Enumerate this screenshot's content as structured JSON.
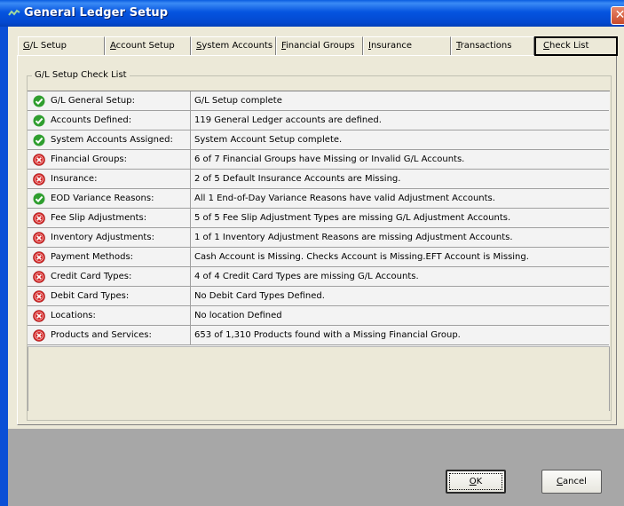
{
  "window": {
    "title": "General Ledger Setup"
  },
  "tabs": [
    {
      "prefix": "",
      "accel": "G",
      "rest": "/L Setup"
    },
    {
      "prefix": "",
      "accel": "A",
      "rest": "ccount Setup"
    },
    {
      "prefix": "",
      "accel": "S",
      "rest": "ystem Accounts"
    },
    {
      "prefix": "",
      "accel": "F",
      "rest": "inancial Groups"
    },
    {
      "prefix": "",
      "accel": "I",
      "rest": "nsurance"
    },
    {
      "prefix": "",
      "accel": "T",
      "rest": "ransactions"
    },
    {
      "prefix": "",
      "accel": "C",
      "rest": "heck List",
      "selected": true
    }
  ],
  "group": {
    "label": "G/L Setup Check List"
  },
  "checklist": [
    {
      "status": "ok",
      "icon": "green-check-icon",
      "name": "G/L General Setup:",
      "message": "G/L Setup complete"
    },
    {
      "status": "ok",
      "icon": "green-check-icon",
      "name": "Accounts Defined:",
      "message": "119 General Ledger accounts are defined."
    },
    {
      "status": "ok",
      "icon": "green-check-icon",
      "name": "System Accounts Assigned:",
      "message": "System Account Setup complete."
    },
    {
      "status": "error",
      "icon": "red-x-icon",
      "name": "Financial Groups:",
      "message": "6 of 7 Financial Groups have Missing or Invalid G/L Accounts."
    },
    {
      "status": "error",
      "icon": "red-x-icon",
      "name": "Insurance:",
      "message": "2 of 5 Default Insurance Accounts are Missing."
    },
    {
      "status": "ok",
      "icon": "green-check-icon",
      "name": "EOD Variance Reasons:",
      "message": "All 1 End-of-Day Variance Reasons have valid Adjustment Accounts."
    },
    {
      "status": "error",
      "icon": "red-x-icon",
      "name": "Fee Slip Adjustments:",
      "message": "5 of 5  Fee Slip Adjustment Types are missing G/L Adjustment Accounts."
    },
    {
      "status": "error",
      "icon": "red-x-icon",
      "name": "Inventory Adjustments:",
      "message": "1 of 1  Inventory Adjustment Reasons are missing Adjustment Accounts."
    },
    {
      "status": "error",
      "icon": "red-x-icon",
      "name": "Payment Methods:",
      "message": "Cash Account is Missing.  Checks Account is Missing.EFT Account is Missing."
    },
    {
      "status": "error",
      "icon": "red-x-icon",
      "name": "Credit Card Types:",
      "message": "4 of 4 Credit Card Types are missing G/L Accounts."
    },
    {
      "status": "error",
      "icon": "red-x-icon",
      "name": "Debit Card Types:",
      "message": "No Debit Card Types Defined."
    },
    {
      "status": "error",
      "icon": "red-x-icon",
      "name": "Locations:",
      "message": "No location Defined"
    },
    {
      "status": "error",
      "icon": "red-x-icon",
      "name": "Products and Services:",
      "message": "653 of 1,310 Products found with a Missing Financial Group."
    }
  ],
  "buttons": {
    "ok": {
      "accel": "O",
      "rest": "K"
    },
    "cancel": {
      "accel": "C",
      "rest": "ancel"
    }
  },
  "colors": {
    "ok": "#2f9e2f",
    "error": "#d42a2a",
    "titlebar": "#0554e0"
  }
}
